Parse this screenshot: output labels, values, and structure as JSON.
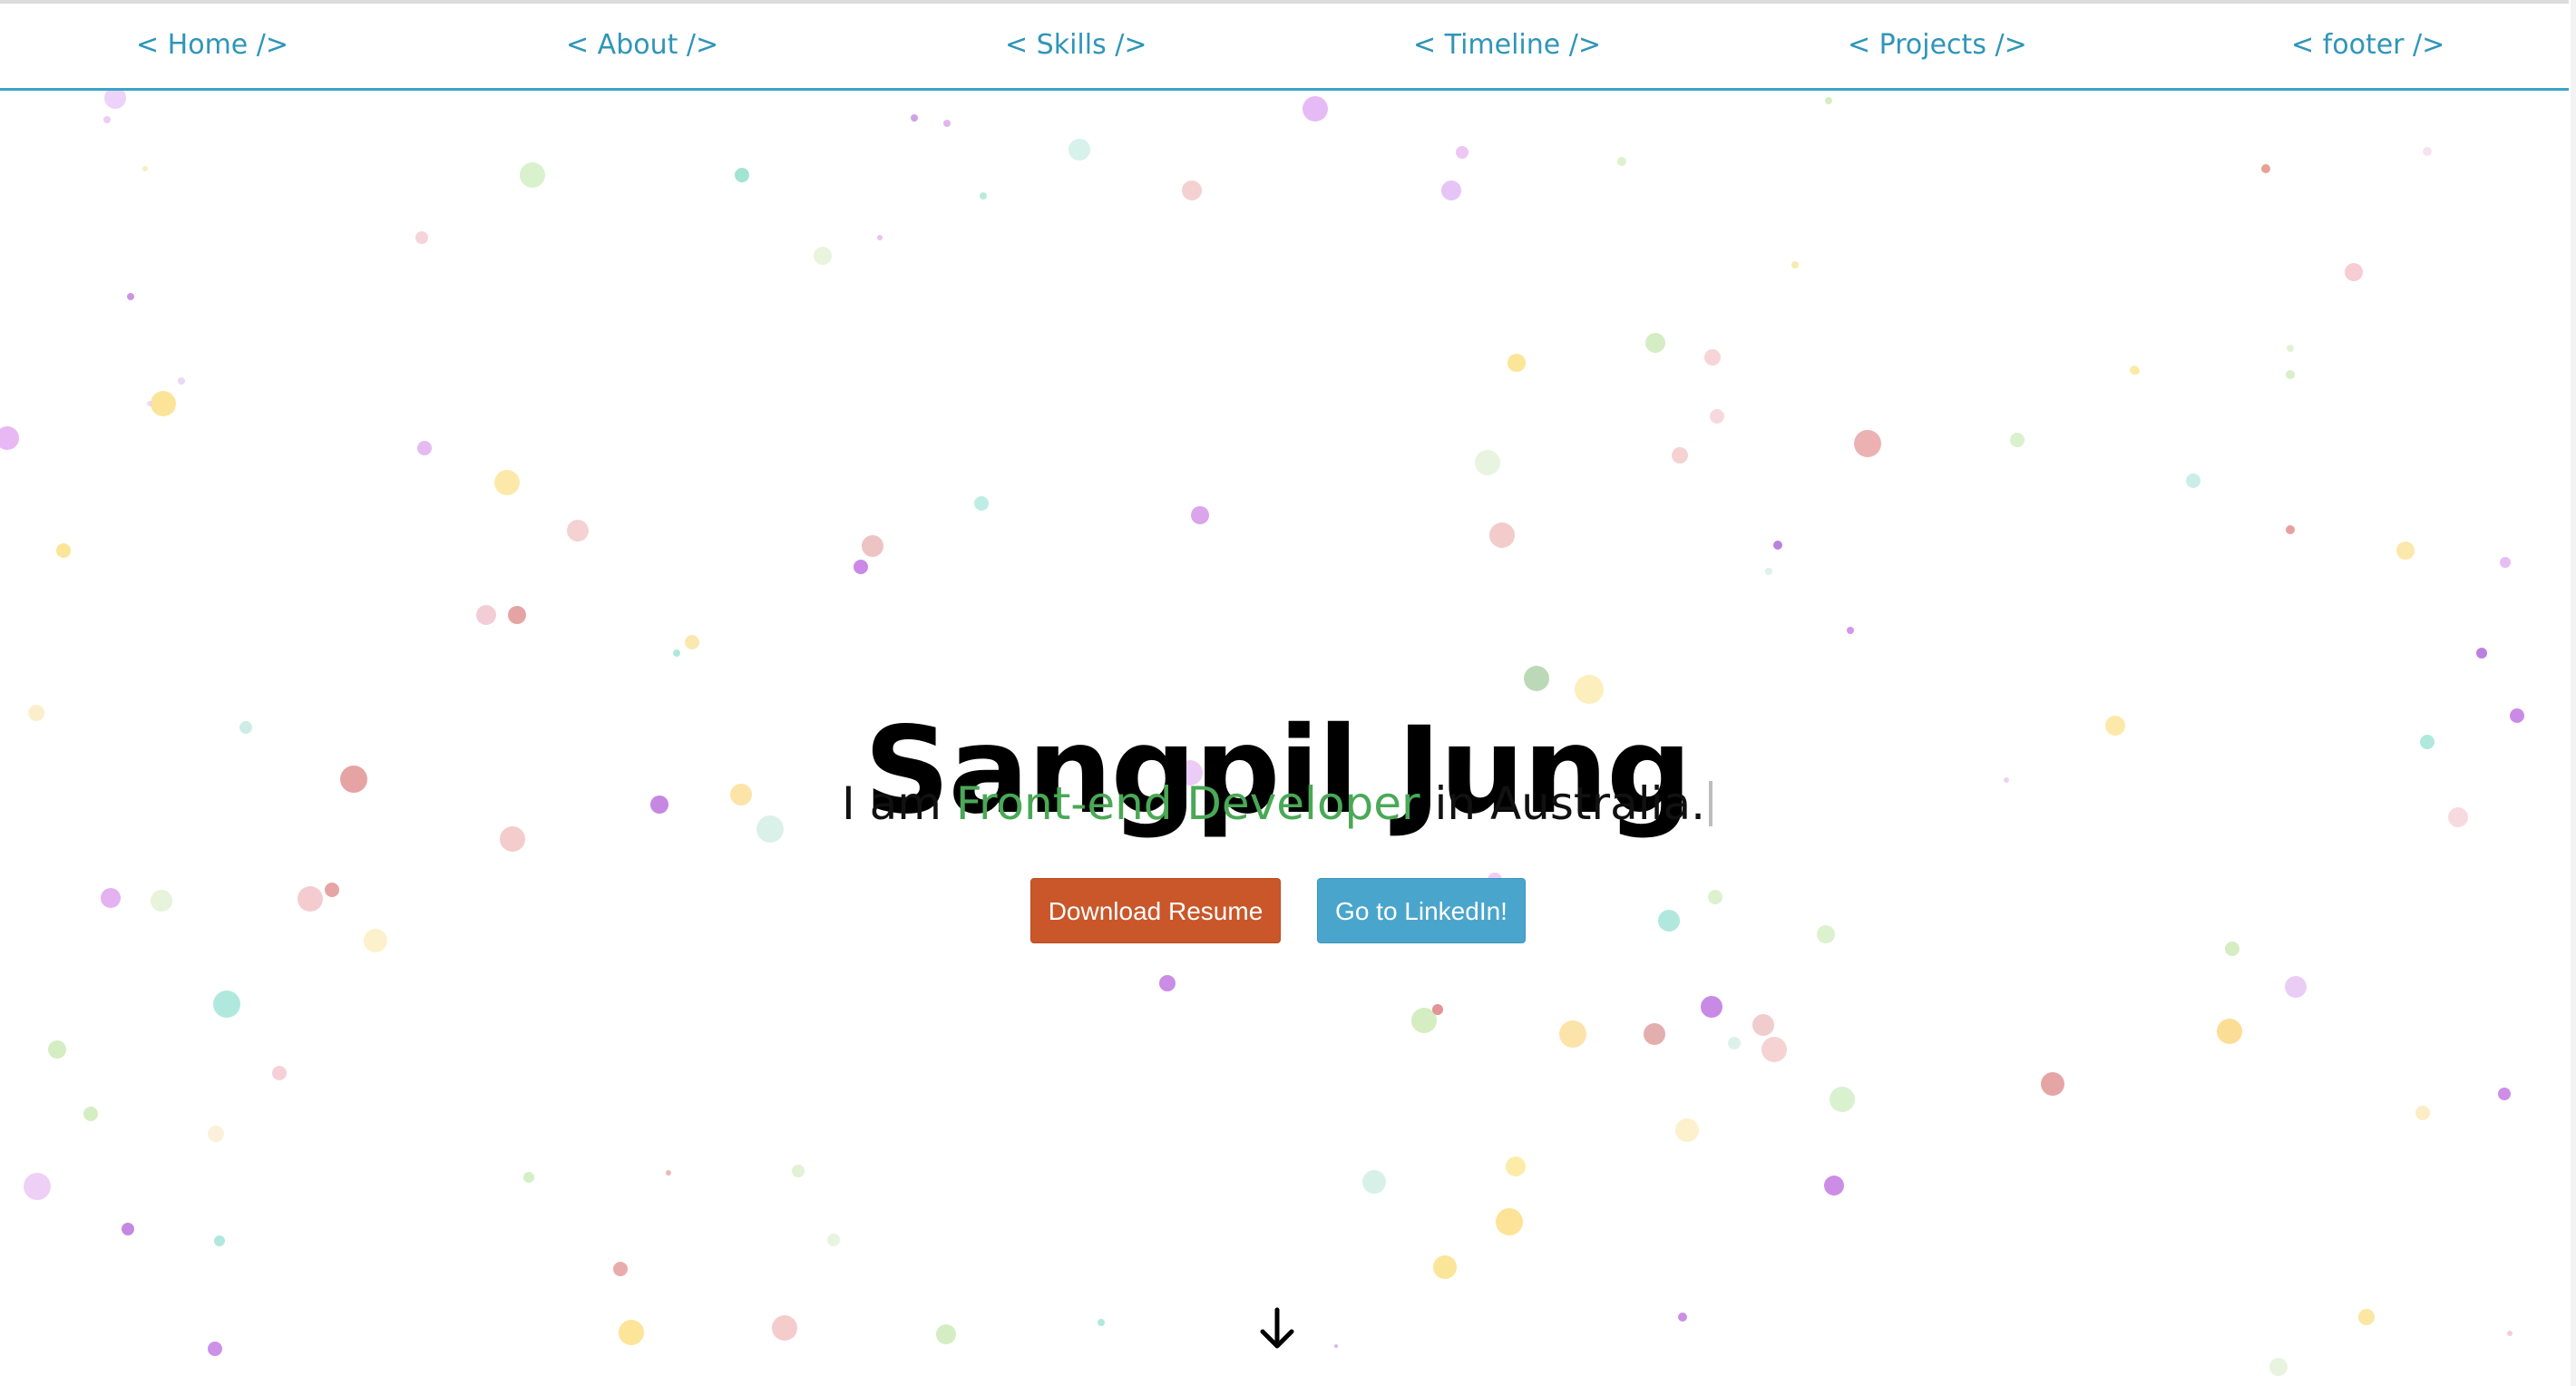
{
  "nav": {
    "items": [
      {
        "label": "< Home />"
      },
      {
        "label": "< About />"
      },
      {
        "label": "< Skills />"
      },
      {
        "label": "< Timeline />"
      },
      {
        "label": "< Projects />"
      },
      {
        "label": "< footer />"
      }
    ]
  },
  "hero": {
    "name": "Sangpil Jung",
    "sub_prefix": "I am ",
    "sub_role": "Front-end Developer",
    "sub_suffix": " in Australia."
  },
  "buttons": {
    "resume_label": "Download Resume",
    "linkedin_label": "Go to LinkedIn!"
  },
  "icons": {
    "scroll_down": "arrow-down-icon"
  },
  "colors": {
    "accent": "#3aa3c8",
    "nav_text": "#2f95b9",
    "role_text": "#4aa856",
    "resume_button": "#c9572a",
    "linkedin_button": "#4aa5cc",
    "particle_palette": [
      "#e7b7f5",
      "#c0e7c0",
      "#f5d6d6",
      "#bfe9e0",
      "#fbe39a",
      "#d98585",
      "#b874e0"
    ]
  }
}
